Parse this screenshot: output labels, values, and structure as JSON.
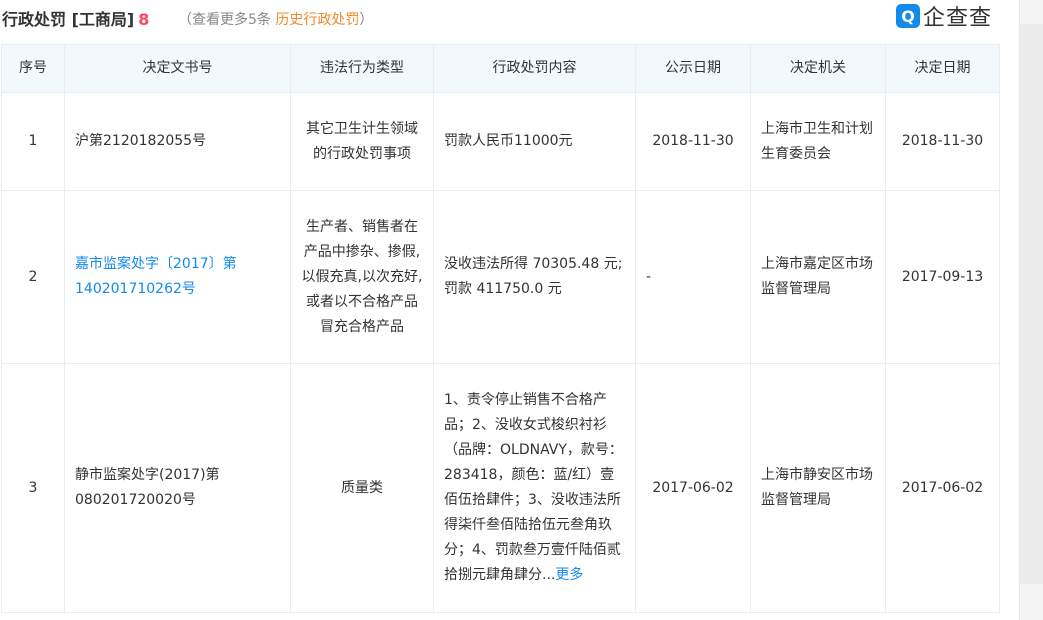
{
  "header": {
    "title": "行政处罚 [工商局]",
    "count": "8",
    "sub_prefix": "（查看更多5条",
    "sub_link": "历史行政处罚",
    "sub_suffix": "）"
  },
  "logo": {
    "mark": "Q",
    "text": "企查查"
  },
  "table": {
    "headers": [
      "序号",
      "决定文书号",
      "违法行为类型",
      "行政处罚内容",
      "公示日期",
      "决定机关",
      "决定日期"
    ],
    "rows": [
      {
        "index": "1",
        "doc_no": "沪第2120182055号",
        "type": "其它卫生计生领域的行政处罚事项",
        "content": "罚款人民币11000元",
        "publish_date": "2018-11-30",
        "authority": "上海市卫生和计划生育委员会",
        "decision_date": "2018-11-30"
      },
      {
        "index": "2",
        "doc_no": "嘉市监案处字〔2017〕第140201710262号",
        "type": "生产者、销售者在产品中掺杂、掺假,以假充真,以次充好,或者以不合格产品冒充合格产品",
        "content": "没收违法所得 70305.48 元;罚款 411750.0 元",
        "publish_date": "-",
        "authority": "上海市嘉定区市场监督管理局",
        "decision_date": "2017-09-13"
      },
      {
        "index": "3",
        "doc_no": "静市监案处字(2017)第080201720020号",
        "type": "质量类",
        "content": "1、责令停止销售不合格产品；2、没收女式梭织衬衫（品牌：OLDNAVY，款号：283418，颜色：蓝/红）壹佰伍拾肆件；3、没收违法所得柒仟叁佰陆拾伍元叁角玖分；4、罚款叁万壹仟陆佰贰拾捌元肆角肆分...",
        "more": "更多",
        "publish_date": "2017-06-02",
        "authority": "上海市静安区市场监督管理局",
        "decision_date": "2017-06-02"
      }
    ]
  },
  "colors": {
    "accent": "#128bed",
    "count": "#fd485e",
    "history_link": "#ef8a29",
    "header_bg": "#f2f9fc",
    "border": "#e4eef6"
  }
}
